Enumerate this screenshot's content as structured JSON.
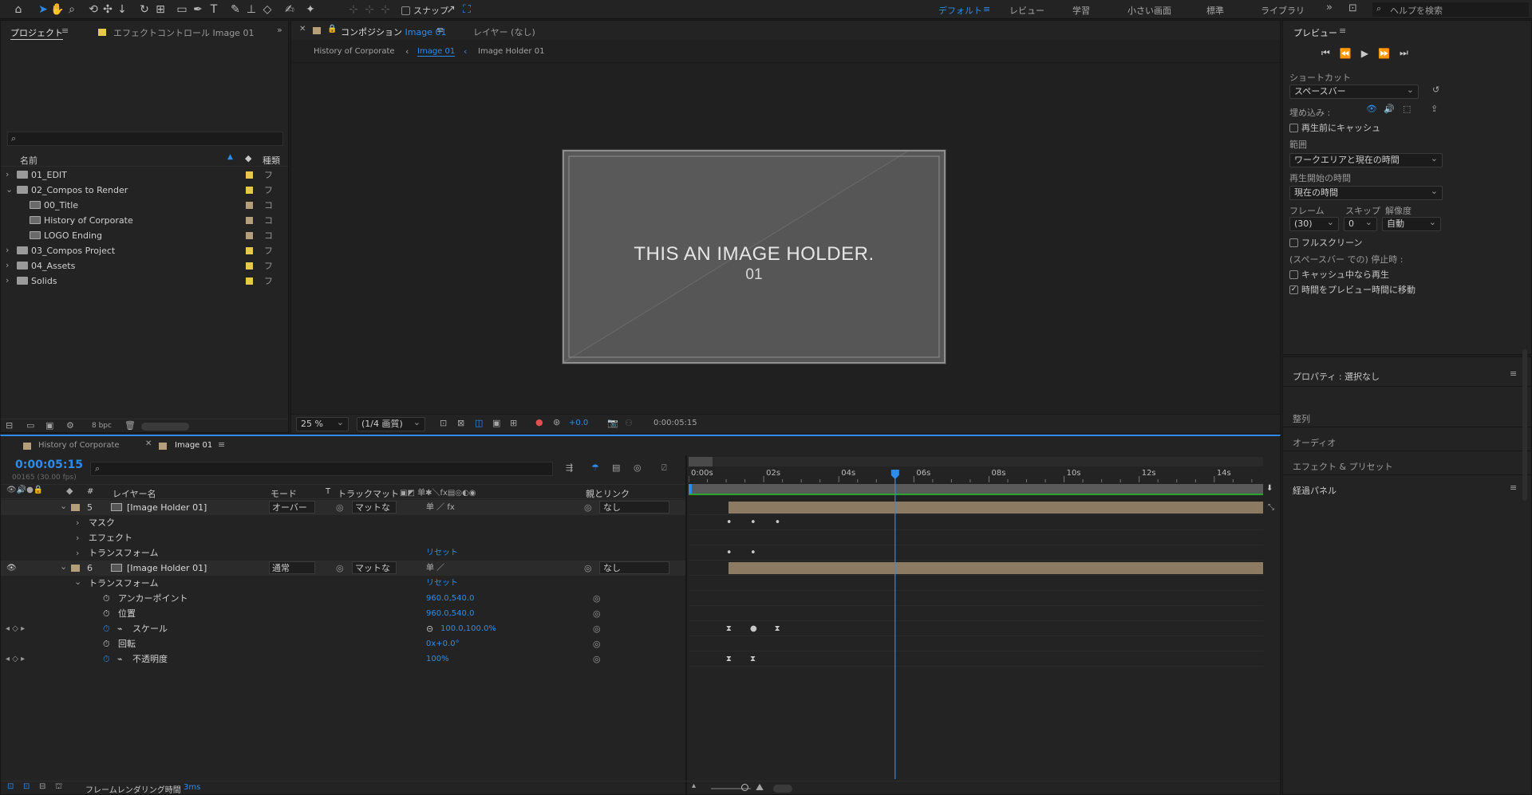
{
  "toolbar": {
    "snap_label": "スナップ",
    "workspaces": [
      "デフォルト",
      "レビュー",
      "学習",
      "小さい画面",
      "標準",
      "ライブラリ"
    ],
    "active_workspace": "デフォルト",
    "search_placeholder": "ヘルプを検索"
  },
  "project_panel": {
    "tab_project": "プロジェクト",
    "tab_effect_controls": "エフェクトコントロール Image 01",
    "search_placeholder": "",
    "col_name": "名前",
    "col_type": "種類",
    "items": [
      {
        "label": "01_EDIT",
        "type": "フ",
        "color": "#e6c84a",
        "folder": true,
        "expanded": false,
        "indent": 0
      },
      {
        "label": "02_Compos to Render",
        "type": "フ",
        "color": "#e6c84a",
        "folder": true,
        "expanded": true,
        "indent": 0
      },
      {
        "label": "00_Title",
        "type": "コ",
        "color": "#b59f7a",
        "folder": false,
        "indent": 1
      },
      {
        "label": "History of Corporate",
        "type": "コ",
        "color": "#b59f7a",
        "folder": false,
        "indent": 1
      },
      {
        "label": "LOGO Ending",
        "type": "コ",
        "color": "#b59f7a",
        "folder": false,
        "indent": 1
      },
      {
        "label": "03_Compos Project",
        "type": "フ",
        "color": "#e6c84a",
        "folder": true,
        "expanded": false,
        "indent": 0
      },
      {
        "label": "04_Assets",
        "type": "フ",
        "color": "#e6c84a",
        "folder": true,
        "expanded": false,
        "indent": 0
      },
      {
        "label": "Solids",
        "type": "フ",
        "color": "#e6c84a",
        "folder": true,
        "expanded": false,
        "indent": 0
      }
    ],
    "bpc": "8 bpc"
  },
  "comp_panel": {
    "tab_comp_prefix": "コンポジション",
    "tab_comp_name": "Image 01",
    "tab_layer": "レイヤー (なし)",
    "breadcrumbs": [
      "History of Corporate",
      "Image 01",
      "Image Holder 01"
    ],
    "canvas_title": "THIS AN IMAGE HOLDER.",
    "canvas_sub": "01",
    "zoom": "25 %",
    "resolution": "(1/4 画質)",
    "exposure": "+0.0",
    "timecode": "0:00:05:15"
  },
  "timeline": {
    "tabs": [
      "History of Corporate",
      "Image 01"
    ],
    "current_time": "0:00:05:15",
    "fps_label": "00165 (30.00 fps)",
    "search_placeholder": "",
    "headers": {
      "layer_name": "レイヤー名",
      "mode": "モード",
      "t": "T",
      "trackmatte": "トラックマット",
      "parent": "親とリンク",
      "num": "#"
    },
    "ruler": [
      "0:00s",
      "02s",
      "04s",
      "06s",
      "08s",
      "10s",
      "12s",
      "14s"
    ],
    "rows": [
      {
        "kind": "layer",
        "num": "5",
        "name": "[Image Holder 01]",
        "mode": "オーバー",
        "matte": "マットな",
        "parent": "なし"
      },
      {
        "kind": "group",
        "label": "マスク"
      },
      {
        "kind": "group",
        "label": "エフェクト"
      },
      {
        "kind": "group",
        "label": "トランスフォーム",
        "value": "リセット"
      },
      {
        "kind": "layer",
        "num": "6",
        "name": "[Image Holder 01]",
        "mode": "通常",
        "matte": "マットな",
        "parent": "なし"
      },
      {
        "kind": "group",
        "label": "トランスフォーム",
        "value": "リセット",
        "open": true
      },
      {
        "kind": "prop",
        "label": "アンカーポイント",
        "value": "960.0,540.0"
      },
      {
        "kind": "prop",
        "label": "位置",
        "value": "960.0,540.0"
      },
      {
        "kind": "prop",
        "label": "スケール",
        "value": "100.0,100.0%",
        "kf": true
      },
      {
        "kind": "prop",
        "label": "回転",
        "value": "0x+0.0°"
      },
      {
        "kind": "prop",
        "label": "不透明度",
        "value": "100%",
        "kf": true
      }
    ],
    "footer_label": "フレームレンダリング時間",
    "footer_value": "3ms",
    "playhead_time": 5.5,
    "duration": 15.3
  },
  "preview_panel": {
    "title": "プレビュー",
    "shortcut_label": "ショートカット",
    "shortcut_value": "スペースバー",
    "embed_label": "埋め込み :",
    "cache_before": "再生前にキャッシュ",
    "range_label": "範囲",
    "range_value": "ワークエリアと現在の時間",
    "start_label": "再生開始の時間",
    "start_value": "現在の時間",
    "frame_label": "フレーム",
    "skip_label": "スキップ",
    "res_label": "解像度",
    "frame_value": "(30)",
    "skip_value": "0",
    "res_value": "自動",
    "fullscreen": "フルスクリーン",
    "stop_label": "(スペースバー での) 停止時 :",
    "stop_opt1": "キャッシュ中なら再生",
    "stop_opt2": "時間をプレビュー時間に移動"
  },
  "right_panels": {
    "properties": "プロパティ : 選択なし",
    "align": "整列",
    "audio": "オーディオ",
    "effects": "エフェクト & プリセット",
    "tracker": "経過パネル"
  }
}
